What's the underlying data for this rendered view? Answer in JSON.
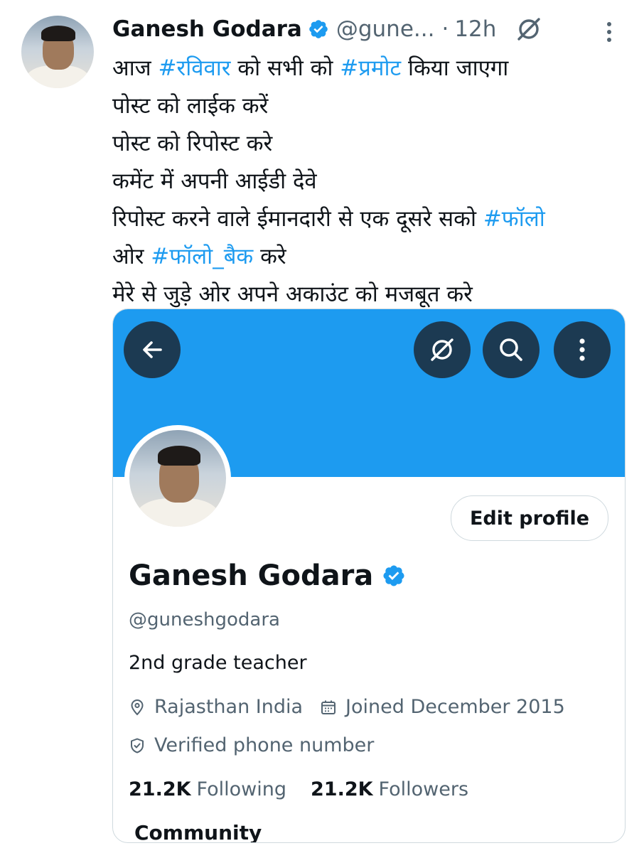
{
  "tweet": {
    "name": "Ganesh Godara",
    "handle": "@gune...",
    "dot": "·",
    "time": "12h",
    "lines": [
      [
        {
          "t": "आज "
        },
        {
          "t": "#रविवार",
          "h": true
        },
        {
          "t": " को सभी को "
        },
        {
          "t": "#प्रमोट",
          "h": true
        },
        {
          "t": " किया जाएगा"
        }
      ],
      [
        {
          "t": "पोस्ट को लाईक करें"
        }
      ],
      [
        {
          "t": "पोस्ट को रिपोस्ट करे"
        }
      ],
      [
        {
          "t": "कमेंट में अपनी आईडी देवे"
        }
      ],
      [
        {
          "t": "रिपोस्ट करने वाले ईमानदारी से एक दूसरे सको "
        },
        {
          "t": "#फॉलो",
          "h": true
        }
      ],
      [
        {
          "t": "ओर "
        },
        {
          "t": "#फॉलो_बैक",
          "h": true
        },
        {
          "t": " करे"
        }
      ],
      [
        {
          "t": "मेरे से जुड़े ओर अपने अकाउंट को मजबूत करे"
        }
      ]
    ]
  },
  "profile_card": {
    "edit_profile": "Edit profile",
    "name": "Ganesh Godara",
    "handle": "@guneshgodara",
    "bio": "2nd grade teacher",
    "location": "Rajasthan India",
    "joined": "Joined December 2015",
    "verified_phone": "Verified phone number",
    "following_count": "21.2K",
    "following_label": "Following",
    "followers_count": "21.2K",
    "followers_label": "Followers",
    "community_label": "Community"
  },
  "icons": {
    "verified": "verified-badge-icon",
    "grok": "grok-icon",
    "more": "more-vertical-icon",
    "back": "back-arrow-icon",
    "search": "search-icon",
    "location": "location-pin-icon",
    "calendar": "calendar-icon",
    "shield": "shield-check-icon"
  },
  "colors": {
    "accent": "#1d9bf0",
    "banner": "#1d9bf0",
    "text": "#0f1419",
    "secondary": "#536471",
    "button_dark": "#1c3a52"
  }
}
